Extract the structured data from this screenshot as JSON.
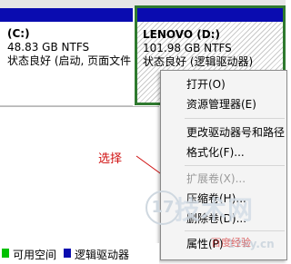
{
  "partitions": [
    {
      "name": "(C:)",
      "size": "48.83 GB NTFS",
      "status": "状态良好 (启动, 页面文件"
    },
    {
      "name": "LENOVO  (D:)",
      "size": "101.98 GB NTFS",
      "status": "状态良好 (逻辑驱动器)"
    }
  ],
  "context_menu": {
    "items": [
      {
        "label": "打开(O)",
        "enabled": true
      },
      {
        "label": "资源管理器(E)",
        "enabled": true
      },
      {
        "label": "更改驱动器号和路径",
        "enabled": true
      },
      {
        "label": "格式化(F)...",
        "enabled": true
      },
      {
        "label": "扩展卷(X)...",
        "enabled": false
      },
      {
        "label": "压缩卷(H)...",
        "enabled": true
      },
      {
        "label": "删除卷(D)...",
        "enabled": true
      },
      {
        "label": "属性(P)",
        "enabled": true
      }
    ]
  },
  "annotation": {
    "text": "选择",
    "color": "#d01010"
  },
  "legend": {
    "items": [
      {
        "label": "可用空间",
        "color": "#00c000"
      },
      {
        "label": "逻辑驱动器",
        "color": "#0a0cb0"
      }
    ]
  },
  "watermark": {
    "number": "17",
    "text": "技术网",
    "site": "17ky.cn",
    "overlay": "百度经验"
  },
  "colors": {
    "partition_header": "#0a0cb0",
    "selection_border": "#2f7a2f"
  }
}
